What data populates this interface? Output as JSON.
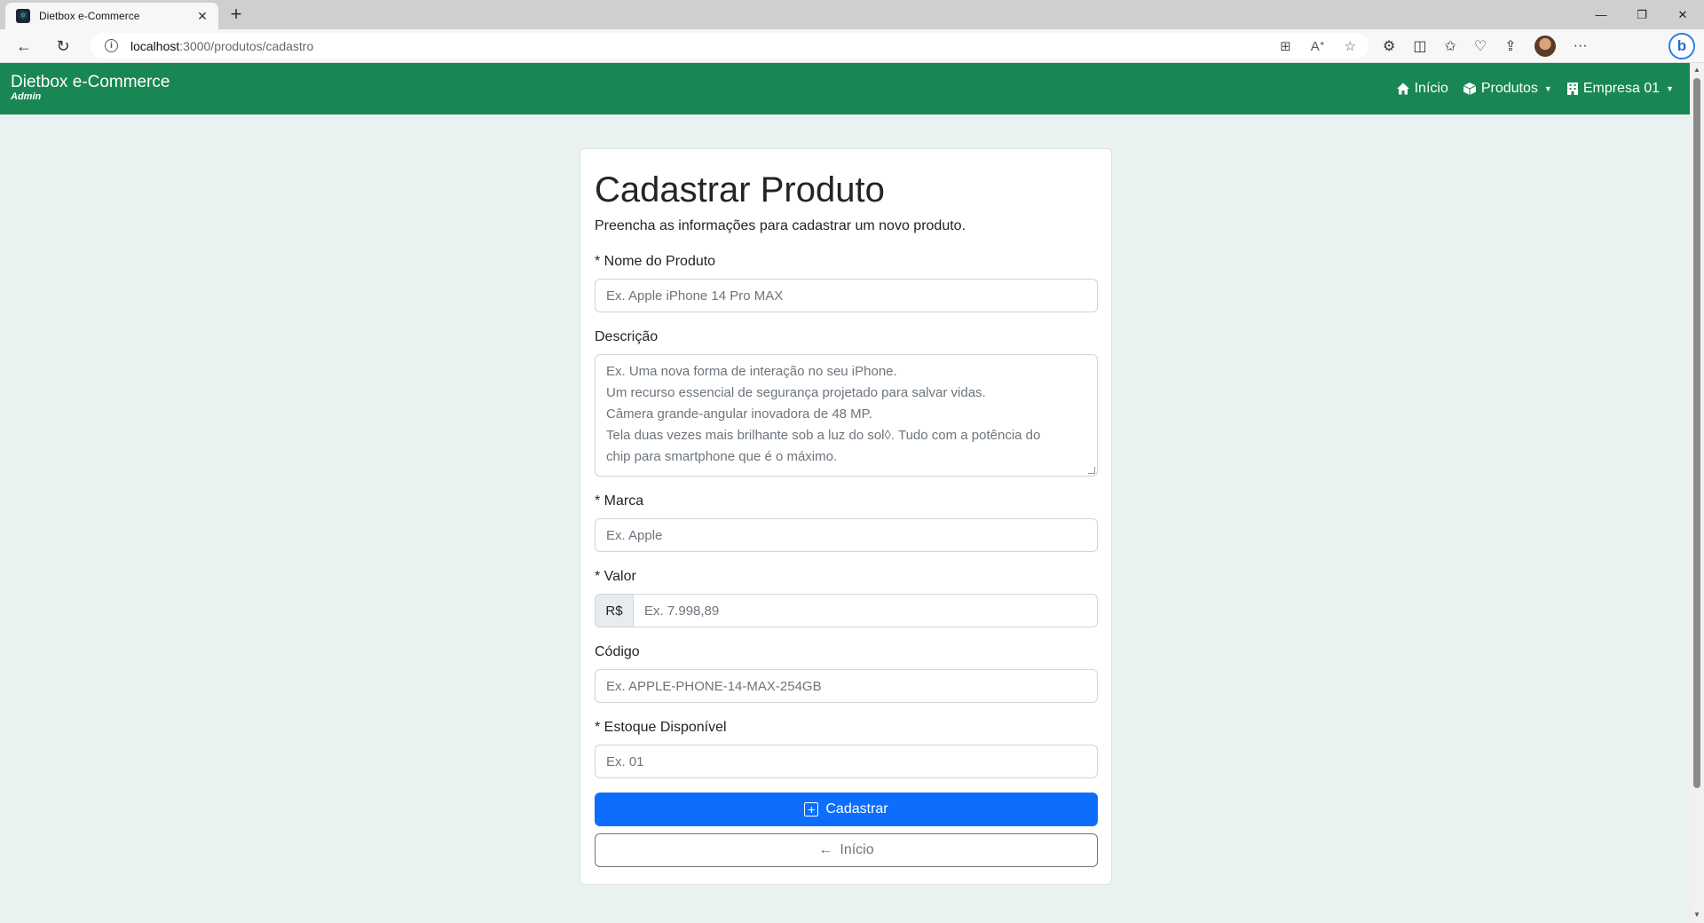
{
  "browser": {
    "tab_title": "Dietbox e-Commerce",
    "url_host": "localhost",
    "url_path": ":3000/produtos/cadastro"
  },
  "navbar": {
    "brand": "Dietbox e-Commerce",
    "brand_sub": "Admin",
    "items": [
      {
        "label": "Início",
        "icon": "home-icon"
      },
      {
        "label": "Produtos",
        "icon": "box-icon"
      },
      {
        "label": "Empresa 01",
        "icon": "building-icon"
      }
    ],
    "color": "#198754"
  },
  "form": {
    "title": "Cadastrar Produto",
    "lead": "Preencha as informações para cadastrar um novo produto.",
    "nome": {
      "label": "* Nome do Produto",
      "placeholder": "Ex. Apple iPhone 14 Pro MAX"
    },
    "descricao": {
      "label": "Descrição",
      "placeholder_lines": [
        "Ex. Uma nova forma de interação no seu iPhone.",
        "Um recurso essencial de segurança projetado para salvar vidas.",
        "Câmera grande-angular inovadora de 48 MP.",
        "Tela duas vezes mais brilhante sob a luz do sol◊. Tudo com a potência do",
        "chip para smartphone que é o máximo."
      ]
    },
    "marca": {
      "label": "* Marca",
      "placeholder": "Ex. Apple"
    },
    "valor": {
      "label": "* Valor",
      "prefix": "R$",
      "placeholder": "Ex. 7.998,89"
    },
    "codigo": {
      "label": "Código",
      "placeholder": "Ex. APPLE-PHONE-14-MAX-254GB"
    },
    "estoque": {
      "label": "* Estoque Disponível",
      "placeholder": "Ex. 01"
    },
    "submit_label": "Cadastrar",
    "back_label": "Início",
    "primary_color": "#0d6efd"
  }
}
